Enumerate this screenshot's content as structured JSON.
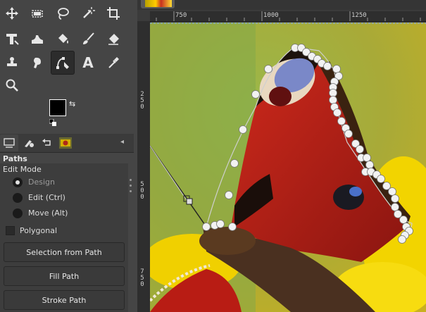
{
  "toolbox": {
    "tools": [
      {
        "name": "move-tool",
        "icon": "move-icon"
      },
      {
        "name": "rect-select-tool",
        "icon": "rect-select-icon"
      },
      {
        "name": "free-select-tool",
        "icon": "lasso-icon"
      },
      {
        "name": "fuzzy-select-tool",
        "icon": "magic-wand-icon"
      },
      {
        "name": "crop-tool",
        "icon": "crop-icon"
      },
      {
        "name": "transform-tool",
        "icon": "transform-icon"
      },
      {
        "name": "warp-tool",
        "icon": "warp-icon"
      },
      {
        "name": "bucket-fill-tool",
        "icon": "bucket-icon"
      },
      {
        "name": "paintbrush-tool",
        "icon": "paintbrush-icon"
      },
      {
        "name": "eraser-tool",
        "icon": "eraser-icon"
      },
      {
        "name": "clone-tool",
        "icon": "clone-icon"
      },
      {
        "name": "smudge-tool",
        "icon": "smudge-icon"
      },
      {
        "name": "paths-tool",
        "icon": "paths-icon",
        "active": true
      },
      {
        "name": "text-tool",
        "icon": "text-icon",
        "label": "A"
      },
      {
        "name": "color-picker-tool",
        "icon": "color-picker-icon"
      },
      {
        "name": "zoom-tool",
        "icon": "zoom-icon"
      }
    ],
    "fg_color": "#000000",
    "bg_color": "#ffffff"
  },
  "panel": {
    "title": "Paths",
    "edit_mode_label": "Edit Mode",
    "modes": [
      {
        "label": "Design",
        "selected": true
      },
      {
        "label": "Edit (Ctrl)",
        "selected": false
      },
      {
        "label": "Move (Alt)",
        "selected": false
      }
    ],
    "polygonal_label": "Polygonal",
    "buttons": {
      "selection_from_path": "Selection from Path",
      "fill_path": "Fill Path",
      "stroke_path": "Stroke Path"
    }
  },
  "rulers": {
    "h_labels": [
      "750",
      "1000",
      "1250"
    ],
    "v_labels": [
      [
        "2",
        "5",
        "0"
      ],
      [
        "5",
        "0",
        "0"
      ],
      [
        "7",
        "5",
        "0"
      ]
    ]
  },
  "colors": {
    "panel_bg": "#454545",
    "ruler_bg": "#2e2e2e",
    "path_stroke": "#c8c8c8"
  }
}
